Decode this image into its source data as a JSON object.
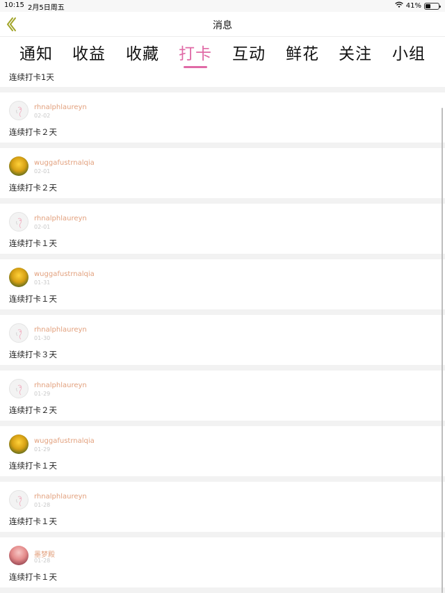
{
  "status_bar": {
    "time": "10:15",
    "date": "2月5日周五",
    "battery_text": "41%",
    "battery_level": 0.41
  },
  "nav": {
    "title": "消息",
    "back_icon": "chevron-left-icon"
  },
  "tabs": [
    {
      "label": "通知",
      "active": false
    },
    {
      "label": "收益",
      "active": false
    },
    {
      "label": "收藏",
      "active": false
    },
    {
      "label": "打卡",
      "active": true
    },
    {
      "label": "互动",
      "active": false
    },
    {
      "label": "鲜花",
      "active": false
    },
    {
      "label": "关注",
      "active": false
    },
    {
      "label": "小组",
      "active": false
    }
  ],
  "colors": {
    "accent": "#e06aa6",
    "username": "#e2a07d",
    "date": "#c8c8c8",
    "background": "#f2f2f2"
  },
  "partial_top_message": "连续打卡1天",
  "items": [
    {
      "username": "rhnalphlaureyn",
      "date": "02-02",
      "message": "连续打卡２天",
      "avatar": "sketch"
    },
    {
      "username": "wuggafustrnalqia",
      "date": "02-01",
      "message": "连续打卡２天",
      "avatar": "sunset"
    },
    {
      "username": "rhnalphlaureyn",
      "date": "02-01",
      "message": "连续打卡１天",
      "avatar": "sketch"
    },
    {
      "username": "wuggafustrnalqia",
      "date": "01-31",
      "message": "连续打卡１天",
      "avatar": "sunset"
    },
    {
      "username": "rhnalphlaureyn",
      "date": "01-30",
      "message": "连续打卡３天",
      "avatar": "sketch"
    },
    {
      "username": "rhnalphlaureyn",
      "date": "01-29",
      "message": "连续打卡２天",
      "avatar": "sketch"
    },
    {
      "username": "wuggafustrnalqia",
      "date": "01-29",
      "message": "连续打卡１天",
      "avatar": "sunset"
    },
    {
      "username": "rhnalphlaureyn",
      "date": "01-28",
      "message": "连续打卡１天",
      "avatar": "sketch"
    },
    {
      "username": "墨梦殿",
      "date": "01-28",
      "message": "连续打卡１天",
      "avatar": "pink"
    }
  ]
}
